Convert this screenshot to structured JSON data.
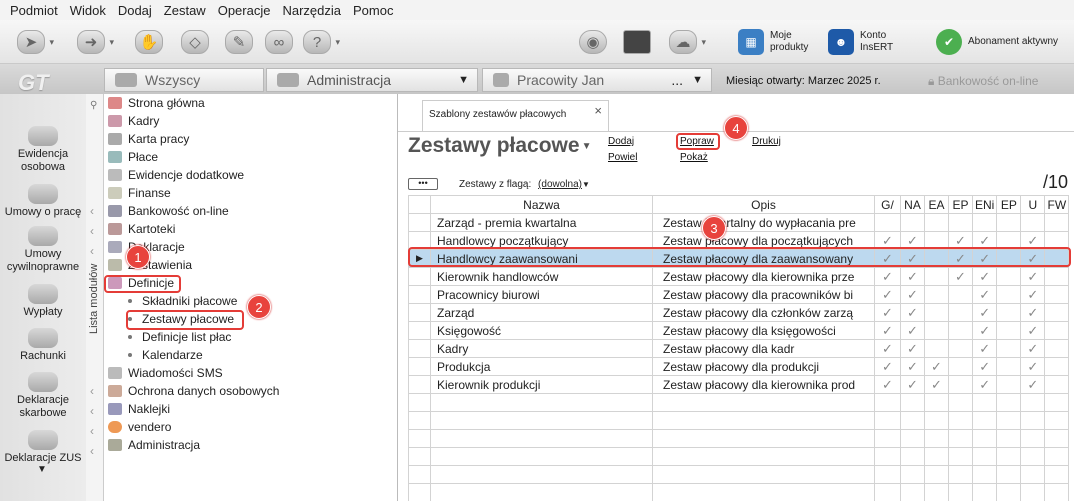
{
  "menu": [
    "Podmiot",
    "Widok",
    "Dodaj",
    "Zestaw",
    "Operacje",
    "Narzędzia",
    "Pomoc"
  ],
  "toolbar": {
    "moje_produkty": "Moje produkty",
    "konto_insert": "Konto InsERT",
    "abonament": "Abonament aktywny"
  },
  "tabs": {
    "wszyscy": "Wszyscy",
    "administracja": "Administracja",
    "pracownik": "Pracowity Jan",
    "dots": "...",
    "month": "Miesiąc otwarty: Marzec 2025 r.",
    "bank": "Bankowość on-line",
    "logo": "GT"
  },
  "left_nav": [
    {
      "label": "Ewidencja osobowa"
    },
    {
      "label": "Umowy o pracę"
    },
    {
      "label": "Umowy cywilnoprawne"
    },
    {
      "label": "Wypłaty"
    },
    {
      "label": "Rachunki"
    },
    {
      "label": "Deklaracje skarbowe"
    },
    {
      "label": "Deklaracje ZUS"
    }
  ],
  "lista_modulow": "Lista modułów",
  "tree": [
    {
      "label": "Strona główna"
    },
    {
      "label": "Kadry"
    },
    {
      "label": "Karta pracy"
    },
    {
      "label": "Płace"
    },
    {
      "label": "Ewidencje dodatkowe"
    },
    {
      "label": "Finanse"
    },
    {
      "label": "Bankowość on-line"
    },
    {
      "label": "Kartoteki"
    },
    {
      "label": "Deklaracje"
    },
    {
      "label": "Zestawienia"
    },
    {
      "label": "Definicje"
    },
    {
      "label": "Składniki płacowe"
    },
    {
      "label": "Zestawy płacowe"
    },
    {
      "label": "Definicje list płac"
    },
    {
      "label": "Kalendarze"
    },
    {
      "label": "Wiadomości SMS"
    },
    {
      "label": "Ochrona danych osobowych"
    },
    {
      "label": "Naklejki"
    },
    {
      "label": "vendero"
    },
    {
      "label": "Administracja"
    }
  ],
  "document": {
    "tab_title": "Szablony zestawów płacowych",
    "title": "Zestawy płacowe",
    "actions": {
      "dodaj": "Dodaj",
      "powiel": "Powiel",
      "popraw": "Popraw",
      "pokaz": "Pokaż",
      "drukuj": "Drukuj"
    },
    "flag_label": "Zestawy z flagą:",
    "flag_value": "(dowolna)",
    "counter": "/10",
    "columns": [
      "Nazwa",
      "Opis",
      "G/",
      "NA",
      "EA",
      "EP",
      "ENi",
      "EP",
      "U",
      "FW"
    ],
    "rows": [
      {
        "name": "Zarząd - premia kwartalna",
        "desc": "Zestaw kwartalny do wypłacania pre",
        "checks": [
          false,
          false,
          false,
          false,
          false,
          false,
          false,
          false
        ]
      },
      {
        "name": "Handlowcy początkujący",
        "desc": "Zestaw płacowy dla początkujących",
        "checks": [
          true,
          true,
          false,
          true,
          true,
          false,
          true,
          false
        ]
      },
      {
        "name": "Handlowcy zaawansowani",
        "desc": "Zestaw płacowy dla zaawansowany",
        "checks": [
          true,
          true,
          false,
          true,
          true,
          false,
          true,
          false
        ]
      },
      {
        "name": "Kierownik handlowców",
        "desc": "Zestaw płacowy dla kierownika prze",
        "checks": [
          true,
          true,
          false,
          true,
          true,
          false,
          true,
          false
        ]
      },
      {
        "name": "Pracownicy biurowi",
        "desc": "Zestaw płacowy dla pracowników bi",
        "checks": [
          true,
          true,
          false,
          false,
          true,
          false,
          true,
          false
        ]
      },
      {
        "name": "Zarząd",
        "desc": "Zestaw płacowy dla członków zarzą",
        "checks": [
          true,
          true,
          false,
          false,
          true,
          false,
          true,
          false
        ]
      },
      {
        "name": "Księgowość",
        "desc": "Zestaw płacowy dla księgowości",
        "checks": [
          true,
          true,
          false,
          false,
          true,
          false,
          true,
          false
        ]
      },
      {
        "name": "Kadry",
        "desc": "Zestaw płacowy dla kadr",
        "checks": [
          true,
          true,
          false,
          false,
          true,
          false,
          true,
          false
        ]
      },
      {
        "name": "Produkcja",
        "desc": "Zestaw płacowy dla produkcji",
        "checks": [
          true,
          true,
          true,
          false,
          true,
          false,
          true,
          false
        ]
      },
      {
        "name": "Kierownik produkcji",
        "desc": "Zestaw płacowy dla kierownika prod",
        "checks": [
          true,
          true,
          true,
          false,
          true,
          false,
          true,
          false
        ]
      }
    ]
  },
  "markers": [
    "1",
    "2",
    "3",
    "4"
  ],
  "colors": {
    "marker": "#e8433d",
    "selected_row": "#bdd9ef"
  }
}
